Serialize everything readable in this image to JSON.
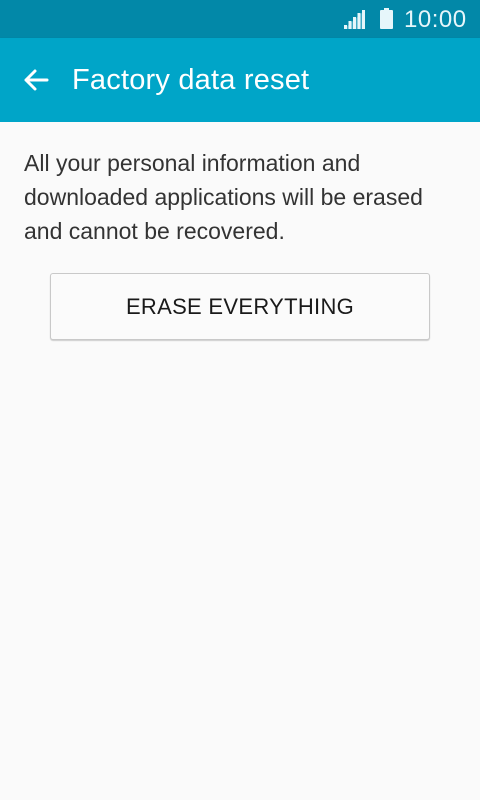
{
  "status_bar": {
    "time": "10:00",
    "signal_icon": "signal-icon",
    "battery_icon": "battery-icon"
  },
  "app_bar": {
    "back_icon": "arrow-back-icon",
    "title": "Factory data reset"
  },
  "content": {
    "message": "All your personal information and downloaded applications will be erased and cannot be recovered.",
    "erase_button_label": "ERASE EVERYTHING"
  },
  "colors": {
    "status_bar": "#0288a8",
    "app_bar": "#00a5c8",
    "background": "#fafafa"
  }
}
